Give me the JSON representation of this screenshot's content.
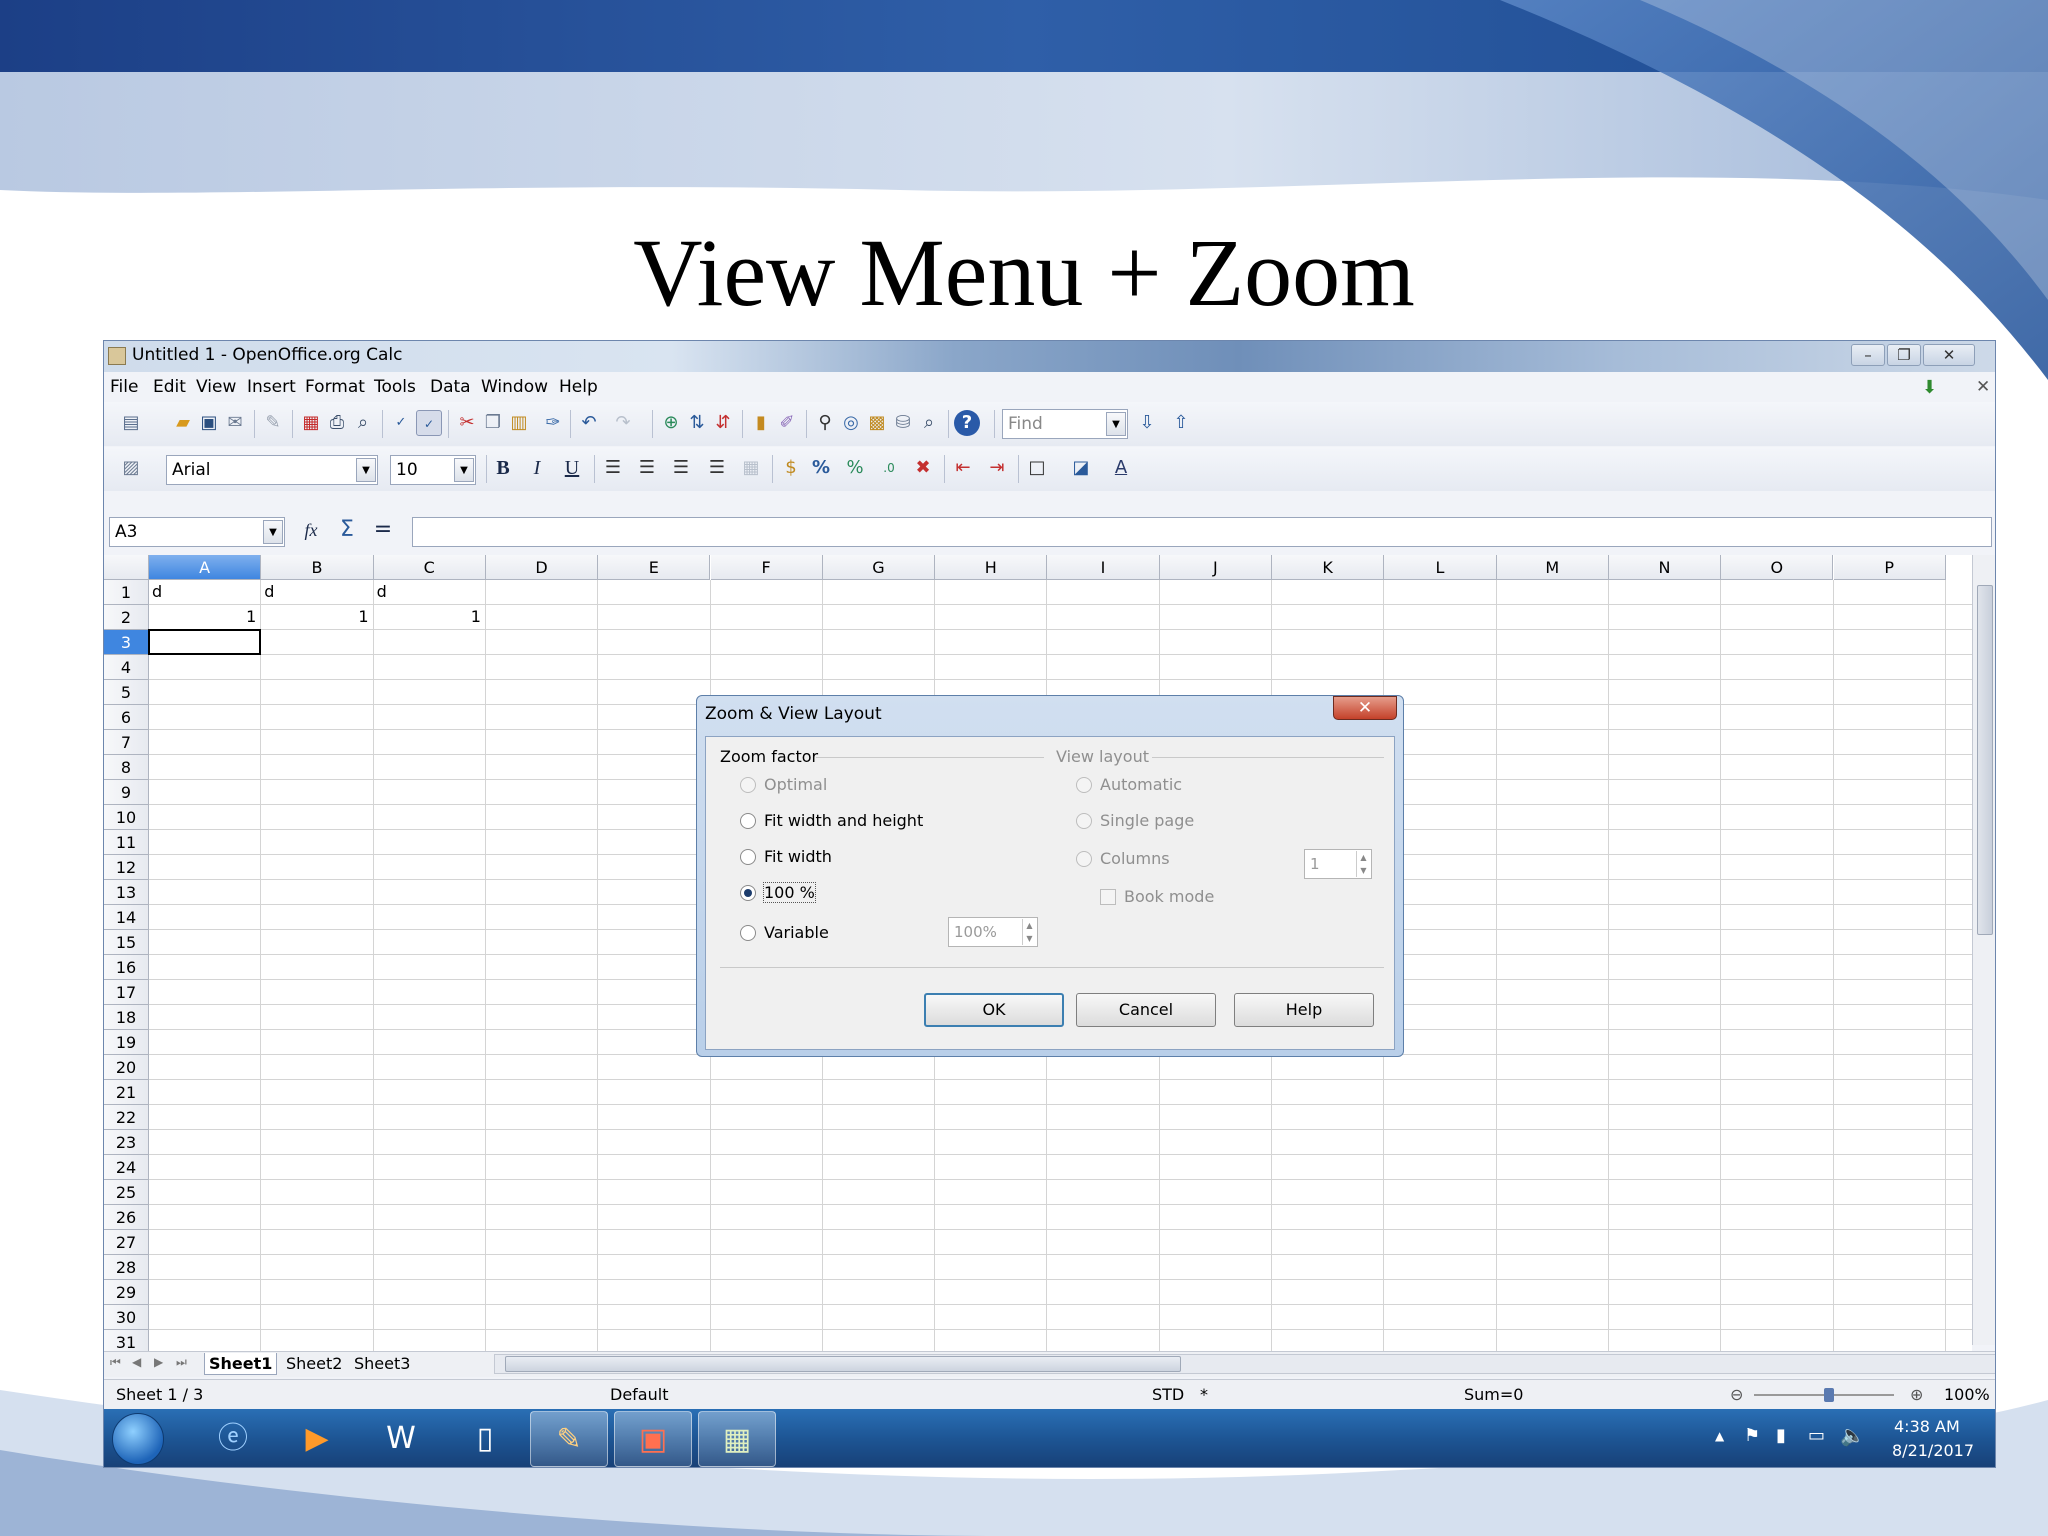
{
  "slide": {
    "title": "View Menu + Zoom"
  },
  "window": {
    "title": "Untitled 1 - OpenOffice.org Calc",
    "min_glyph": "–",
    "max_glyph": "❐",
    "close_glyph": "✕"
  },
  "menu": [
    "File",
    "Edit",
    "View",
    "Insert",
    "Format",
    "Tools",
    "Data",
    "Window",
    "Help"
  ],
  "toolbar": {
    "find_value": "Find",
    "font_name": "Arial",
    "font_size": "10",
    "bold_label": "B",
    "italic_label": "I",
    "underline_label": "U",
    "percent_label": "%",
    "help_glyph": "?"
  },
  "formula_bar": {
    "name_box": "A3",
    "fx_label": "fx",
    "sigma_label": "Σ",
    "equals_label": "="
  },
  "sheet": {
    "columns": [
      "A",
      "B",
      "C",
      "D",
      "E",
      "F",
      "G",
      "H",
      "I",
      "J",
      "K",
      "L",
      "M",
      "N",
      "O",
      "P"
    ],
    "rows": [
      "1",
      "2",
      "3",
      "4",
      "5",
      "6",
      "7",
      "8",
      "9",
      "10",
      "11",
      "12",
      "13",
      "14",
      "15",
      "16",
      "17",
      "18",
      "19",
      "20",
      "21",
      "22",
      "23",
      "24",
      "25",
      "26",
      "27",
      "28",
      "29",
      "30",
      "31"
    ],
    "selected_column": "A",
    "selected_row": "3",
    "cells": {
      "a1": "d",
      "b1": "d",
      "c1": "d",
      "a2": "1",
      "b2": "1",
      "c2": "1"
    },
    "tabs": [
      "Sheet1",
      "Sheet2",
      "Sheet3"
    ],
    "active_tab": "Sheet1"
  },
  "status": {
    "sheet": "Sheet 1 / 3",
    "style": "Default",
    "mode": "STD",
    "modified": "*",
    "sum": "Sum=0",
    "zoom": "100%"
  },
  "dialog": {
    "title": "Zoom & View Layout",
    "close_glyph": "✕",
    "zoom_factor_label": "Zoom factor",
    "view_layout_label": "View layout",
    "zoom_options": [
      {
        "label": "Optimal",
        "enabled": false,
        "checked": false
      },
      {
        "label": "Fit width and height",
        "enabled": true,
        "checked": false
      },
      {
        "label": "Fit width",
        "enabled": true,
        "checked": false
      },
      {
        "label": "100 %",
        "enabled": true,
        "checked": true
      },
      {
        "label": "Variable",
        "enabled": true,
        "checked": false
      }
    ],
    "variable_value": "100%",
    "layout_options": [
      {
        "label": "Automatic",
        "enabled": false
      },
      {
        "label": "Single page",
        "enabled": false
      },
      {
        "label": "Columns",
        "enabled": false
      }
    ],
    "columns_value": "1",
    "book_mode_label": "Book mode",
    "ok_label": "OK",
    "cancel_label": "Cancel",
    "help_label": "Help"
  },
  "taskbar": {
    "time": "4:38 AM",
    "date": "8/21/2017",
    "tray_arrow": "▲"
  }
}
